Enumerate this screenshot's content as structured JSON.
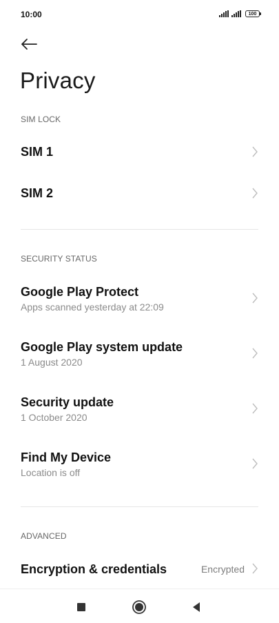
{
  "status_bar": {
    "time": "10:00",
    "battery": "100"
  },
  "header": {
    "title": "Privacy"
  },
  "sections": {
    "sim_lock": {
      "header": "SIM LOCK",
      "items": [
        {
          "title": "SIM 1"
        },
        {
          "title": "SIM 2"
        }
      ]
    },
    "security_status": {
      "header": "SECURITY STATUS",
      "items": [
        {
          "title": "Google Play Protect",
          "subtitle": "Apps scanned yesterday at 22:09"
        },
        {
          "title": "Google Play system update",
          "subtitle": "1 August 2020"
        },
        {
          "title": "Security update",
          "subtitle": "1 October 2020"
        },
        {
          "title": "Find My Device",
          "subtitle": "Location is off"
        }
      ]
    },
    "advanced": {
      "header": "ADVANCED",
      "items": [
        {
          "title": "Encryption & credentials",
          "value": "Encrypted"
        }
      ]
    }
  },
  "nav_bar": {
    "icons": [
      "recents-square-icon",
      "home-circle-icon",
      "back-triangle-icon"
    ]
  },
  "colors": {
    "text_primary": "#111111",
    "text_secondary": "#8a8a8a",
    "section_header": "#666666",
    "divider": "#e6e6e6"
  }
}
